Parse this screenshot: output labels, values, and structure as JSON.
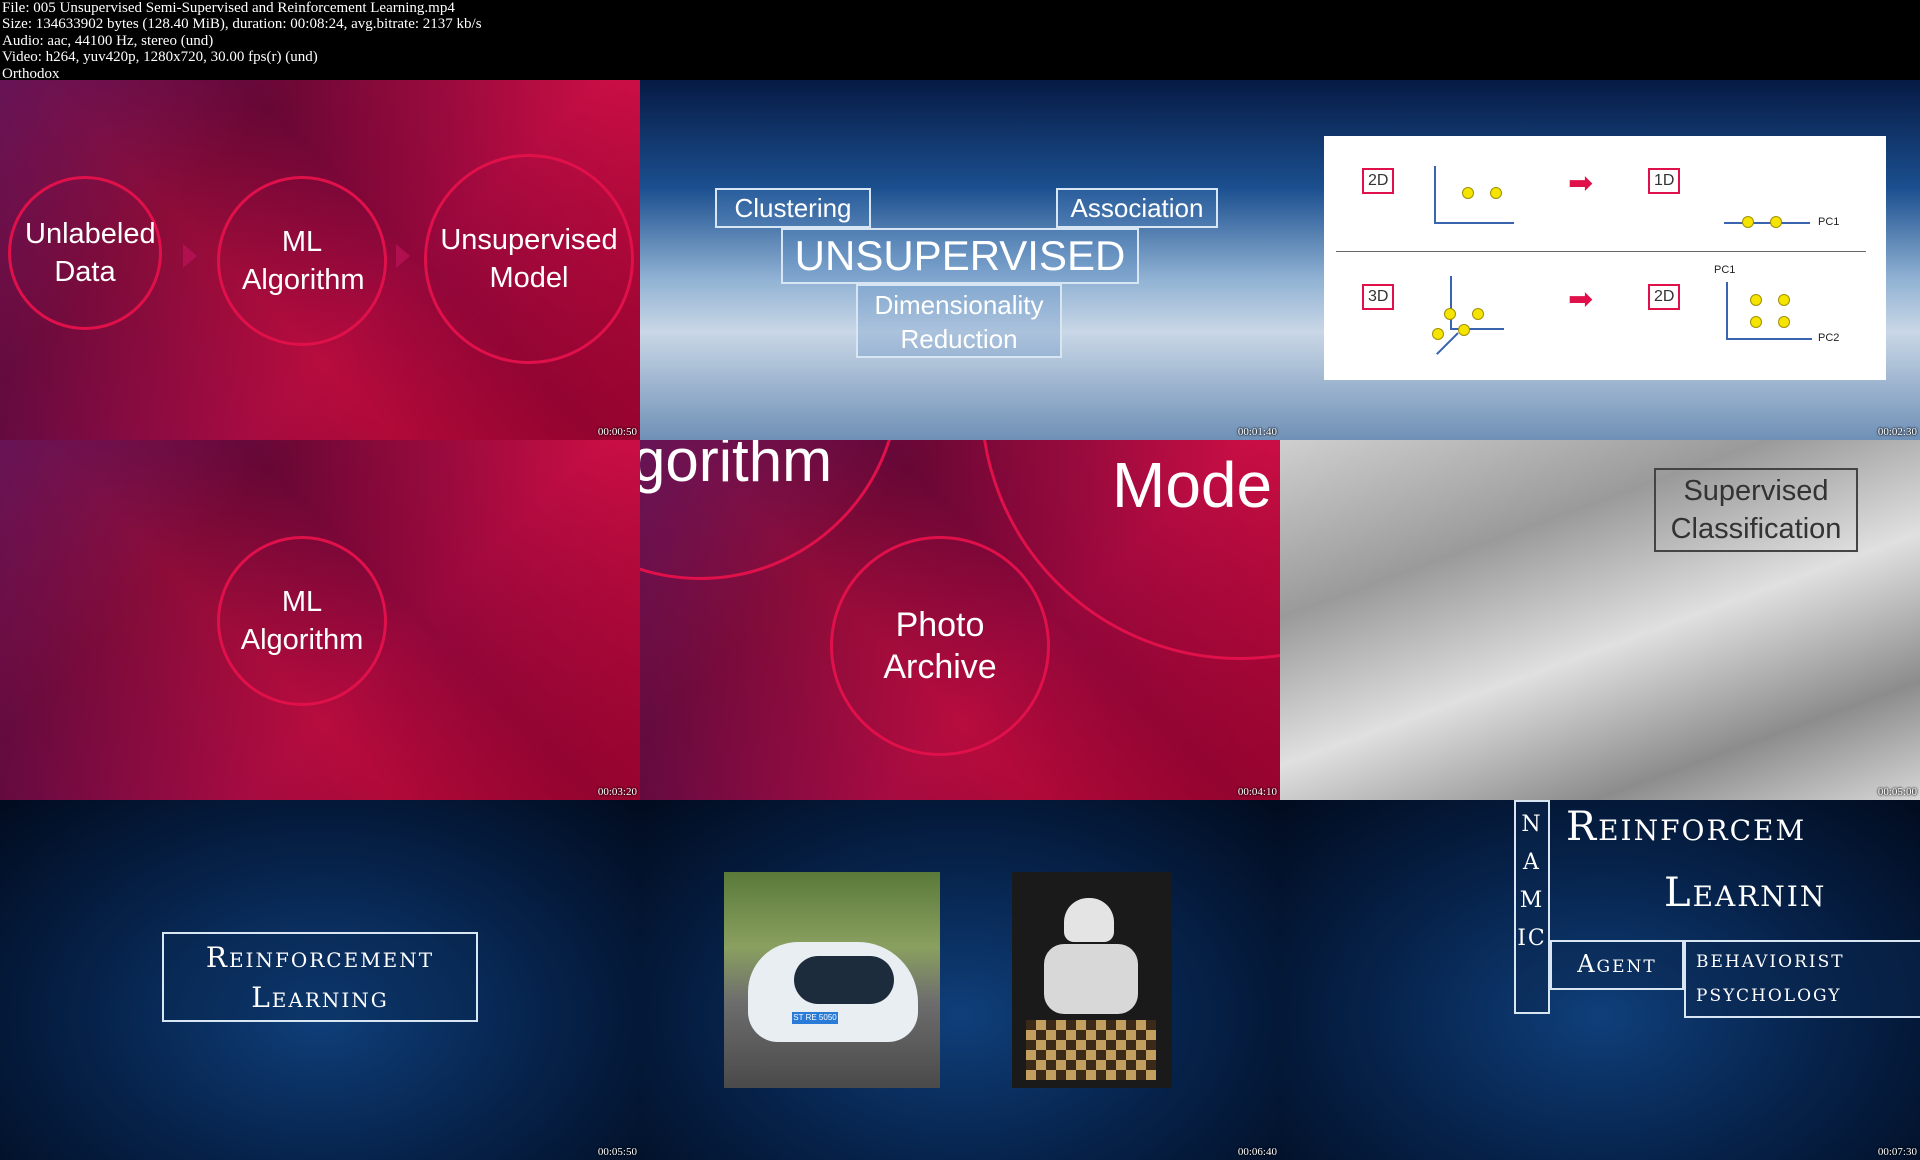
{
  "header": {
    "line1": "File: 005 Unsupervised Semi-Supervised and Reinforcement Learning.mp4",
    "line2": "Size: 134633902 bytes (128.40 MiB), duration: 00:08:24, avg.bitrate: 2137 kb/s",
    "line3": "Audio: aac, 44100 Hz, stereo (und)",
    "line4": "Video: h264, yuv420p, 1280x720, 30.00 fps(r) (und)",
    "line5": "Orthodox"
  },
  "thumbs": [
    {
      "time": "00:00:50",
      "c1": "Unlabeled Data",
      "c2": "ML Algorithm",
      "c3": "Unsupervised Model"
    },
    {
      "time": "00:01:40",
      "clustering": "Clustering",
      "association": "Association",
      "unsupervised": "UNSUPERVISED",
      "dim1": "Dimensionality",
      "dim2": "Reduction"
    },
    {
      "time": "00:02:30",
      "t2d": "2D",
      "t1d": "1D",
      "t3d": "3D",
      "t2d_b": "2D",
      "pc1_top": "PC1",
      "pc1": "PC1",
      "pc2": "PC2"
    },
    {
      "time": "00:03:20",
      "ml1": "ML",
      "ml2": "Algorithm"
    },
    {
      "time": "00:04:10",
      "frag_left": "gorithm",
      "frag_right": "Mode",
      "photo1": "Photo",
      "photo2": "Archive"
    },
    {
      "time": "00:05:00",
      "sup1": "Supervised",
      "sup2": "Classification"
    },
    {
      "time": "00:05:50",
      "rl1": "Reinforcement",
      "rl2": "Learning"
    },
    {
      "time": "00:06:40",
      "plate": "ST RE 5050"
    },
    {
      "time": "00:07:30",
      "vertical": "NAMIC",
      "rein": "Reinforcem",
      "learn": "Learnin",
      "agent": "Agent",
      "beh1": "behaviorist",
      "beh2": "psychology"
    }
  ]
}
